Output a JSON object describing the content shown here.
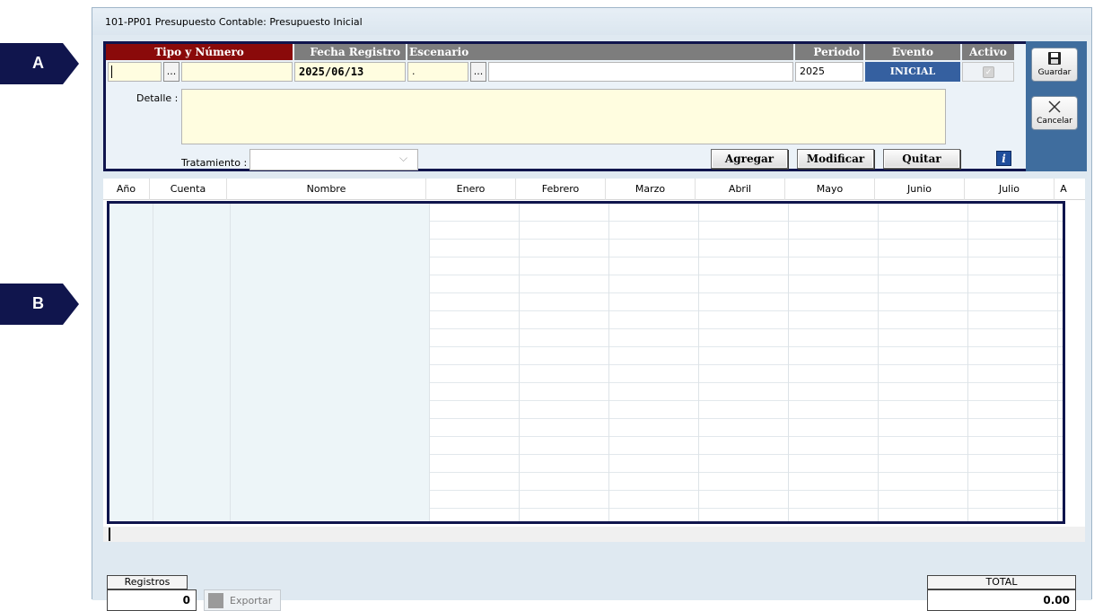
{
  "window": {
    "title": "101-PP01  Presupuesto Contable: Presupuesto Inicial"
  },
  "markers": {
    "a": "A",
    "b": "B"
  },
  "form": {
    "headers": {
      "tipo_numero": "Tipo y Número",
      "fecha_registro": "Fecha Registro",
      "escenario": "Escenario",
      "periodo": "Periodo",
      "evento": "Evento",
      "activo": "Activo"
    },
    "dots_label": "...",
    "fecha_value": "2025/06/13",
    "escenario_value": ".",
    "periodo_value": "2025",
    "evento_value": "INICIAL",
    "detalle_label": "Detalle :",
    "tratamiento_label": "Tratamiento :",
    "buttons": {
      "agregar": "Agregar",
      "modificar": "Modificar",
      "quitar": "Quitar"
    },
    "info_glyph": "i"
  },
  "side": {
    "guardar": "Guardar",
    "cancelar": "Cancelar"
  },
  "grid": {
    "columns": [
      "Año",
      "Cuenta",
      "Nombre",
      "Enero",
      "Febrero",
      "Marzo",
      "Abril",
      "Mayo",
      "Junio",
      "Julio",
      "A"
    ]
  },
  "footer": {
    "registros_label": "Registros",
    "registros_value": "0",
    "exportar_label": "Exportar",
    "total_label": "TOTAL",
    "total_value": "0.00"
  },
  "colors": {
    "marker": "#10154d",
    "header_red": "#8a0a0a",
    "evento_blue": "#3560a0"
  }
}
